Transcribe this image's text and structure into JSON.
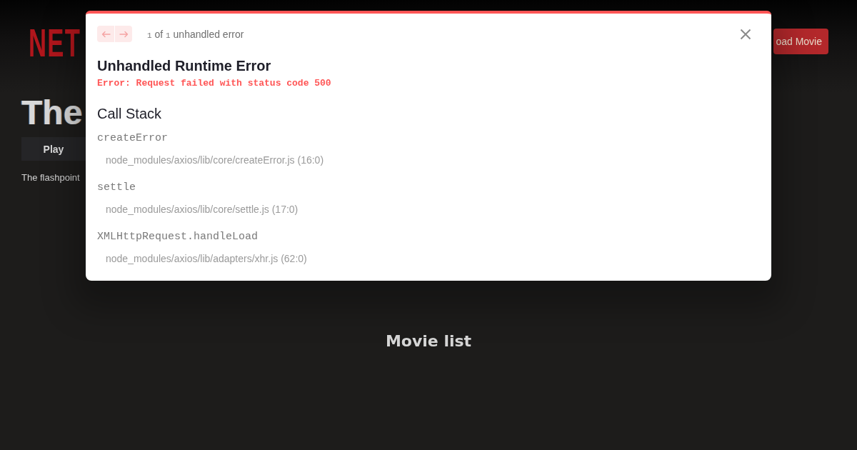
{
  "header": {
    "logo": "NET",
    "load_button": "oad Movie"
  },
  "hero": {
    "title": "The",
    "play_button": "Play",
    "description": "The flashpoint"
  },
  "movie_section": {
    "title": "Movie list"
  },
  "error_overlay": {
    "nav_buttons": [
      {
        "kind": "previous",
        "disabled": true
      },
      {
        "kind": "next",
        "disabled": true
      }
    ],
    "counter": {
      "current": "1",
      "separator": "of",
      "total": "1",
      "label": "unhandled error"
    },
    "title": "Unhandled Runtime Error",
    "message": "Error: Request failed with status code 500",
    "call_stack": {
      "heading": "Call Stack",
      "frames": [
        {
          "function": "createError",
          "location": "node_modules/axios/lib/core/createError.js (16:0)"
        },
        {
          "function": "settle",
          "location": "node_modules/axios/lib/core/settle.js (17:0)"
        },
        {
          "function": "XMLHttpRequest.handleLoad",
          "location": "node_modules/axios/lib/adapters/xhr.js (62:0)"
        }
      ]
    }
  }
}
